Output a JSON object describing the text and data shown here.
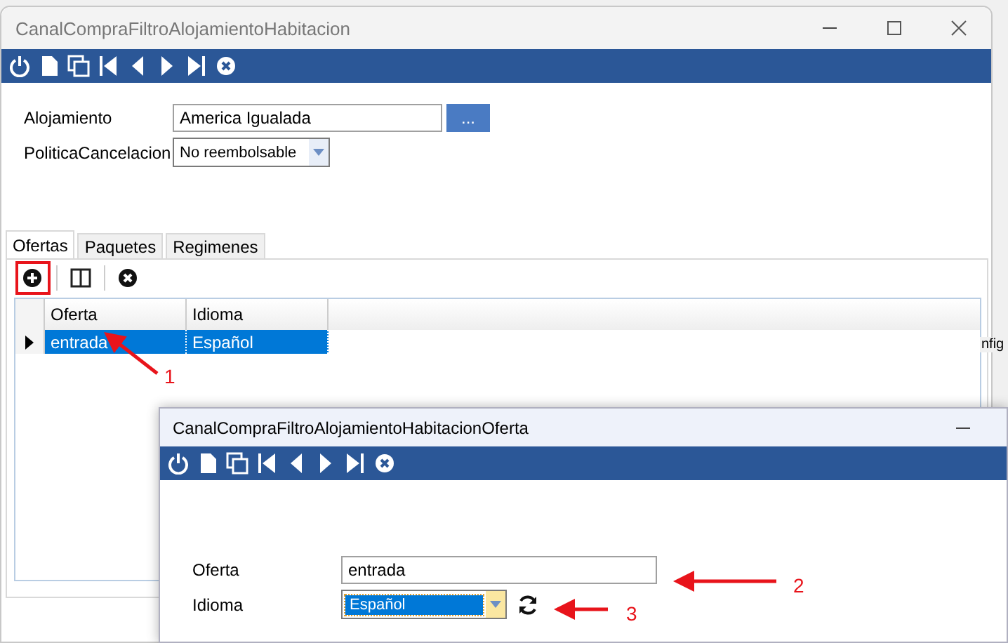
{
  "main_window": {
    "title": "CanalCompraFiltroAlojamientoHabitacion",
    "toolbar": [
      {
        "kind": "power"
      },
      {
        "kind": "new"
      },
      {
        "kind": "copy"
      },
      {
        "kind": "first"
      },
      {
        "kind": "prev"
      },
      {
        "kind": "next"
      },
      {
        "kind": "last"
      },
      {
        "kind": "delete"
      }
    ],
    "fields": [
      {
        "label": "Alojamiento",
        "kind": "lookup",
        "value": "America Igualada",
        "button": "..."
      },
      {
        "label": "PoliticaCancelacion",
        "kind": "dropdown",
        "value": "No reembolsable",
        "focused": false
      }
    ],
    "tabs": [
      {
        "label": "Ofertas",
        "selected": true
      },
      {
        "label": "Paquetes",
        "selected": false
      },
      {
        "label": "Regimenes",
        "selected": false
      }
    ],
    "grid_toolbar": [
      {
        "kind": "add",
        "highlighted": true
      },
      {
        "kind": "columns",
        "highlighted": false
      },
      {
        "kind": "delete",
        "highlighted": false
      }
    ],
    "table": {
      "columns": [
        "Oferta",
        "Idioma"
      ],
      "rows": [
        {
          "cells": [
            "entrada",
            "Español"
          ],
          "selected": true
        }
      ]
    }
  },
  "background_fragment": "nfig",
  "dialog": {
    "title": "CanalCompraFiltroAlojamientoHabitacionOferta",
    "toolbar": [
      {
        "kind": "power"
      },
      {
        "kind": "new"
      },
      {
        "kind": "copy"
      },
      {
        "kind": "first"
      },
      {
        "kind": "prev"
      },
      {
        "kind": "next"
      },
      {
        "kind": "last"
      },
      {
        "kind": "delete"
      }
    ],
    "fields": [
      {
        "label": "Oferta",
        "kind": "text",
        "value": "entrada"
      },
      {
        "label": "Idioma",
        "kind": "dropdown",
        "value": "Español",
        "focused": true,
        "refresh": true
      }
    ]
  },
  "annotations": [
    {
      "label": "1"
    },
    {
      "label": "2"
    },
    {
      "label": "3"
    }
  ]
}
